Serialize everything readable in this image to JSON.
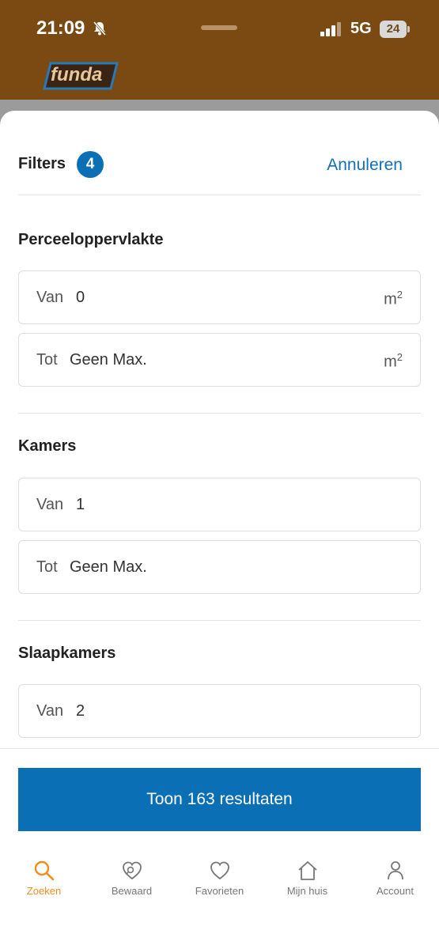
{
  "status": {
    "time": "21:09",
    "network": "5G",
    "battery": "24"
  },
  "app": {
    "logo_text": "funda"
  },
  "header": {
    "title": "Filters",
    "badge_count": "4",
    "cancel": "Annuleren"
  },
  "sections": [
    {
      "title": "Perceeloppervlakte",
      "fields": [
        {
          "prefix": "Van",
          "value": "0",
          "unit": "m"
        },
        {
          "prefix": "Tot",
          "value": "Geen Max.",
          "unit": "m"
        }
      ]
    },
    {
      "title": "Kamers",
      "fields": [
        {
          "prefix": "Van",
          "value": "1"
        },
        {
          "prefix": "Tot",
          "value": "Geen Max."
        }
      ]
    },
    {
      "title": "Slaapkamers",
      "fields": [
        {
          "prefix": "Van",
          "value": "2"
        }
      ]
    }
  ],
  "unit_exponent": "2",
  "footer": {
    "button_label": "Toon 163 resultaten"
  },
  "tabs": [
    {
      "label": "Zoeken",
      "icon": "search-icon",
      "active": true
    },
    {
      "label": "Bewaard",
      "icon": "saved-search-icon"
    },
    {
      "label": "Favorieten",
      "icon": "heart-icon"
    },
    {
      "label": "Mijn huis",
      "icon": "home-icon"
    },
    {
      "label": "Account",
      "icon": "person-icon"
    }
  ],
  "colors": {
    "accent": "#0b6fb5",
    "brand": "#7a4a12",
    "active_tab": "#f28c1e"
  }
}
